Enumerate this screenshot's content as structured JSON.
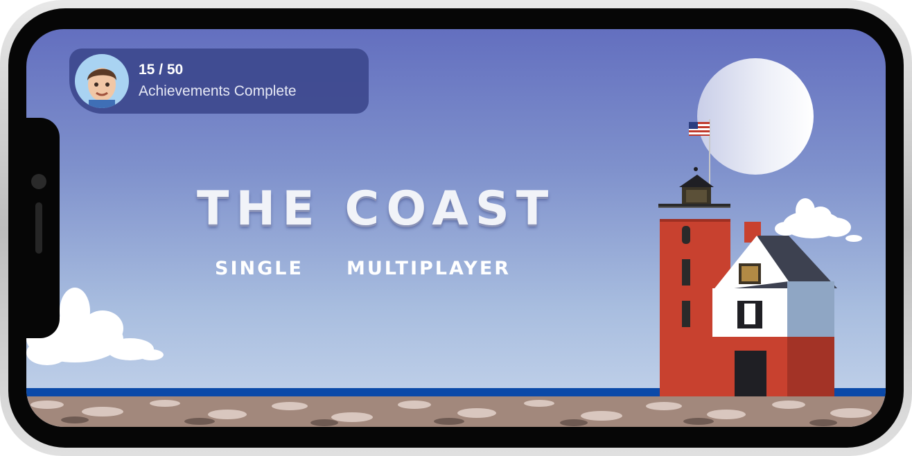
{
  "hud": {
    "achievements_count": "15 / 50",
    "achievements_label": "Achievements Complete"
  },
  "game": {
    "title": "THE COAST"
  },
  "menu": {
    "single_label": "SINGLE",
    "multiplayer_label": "MULTIPLAYER"
  },
  "colors": {
    "sky_top": "#636fbf",
    "sky_bottom": "#c7d6ec",
    "sea": "#0b49a8",
    "hud_bg": "#3e4a8f",
    "lighthouse_red": "#c8412f"
  },
  "icons": [
    "avatar-memoji",
    "us-flag-icon"
  ]
}
